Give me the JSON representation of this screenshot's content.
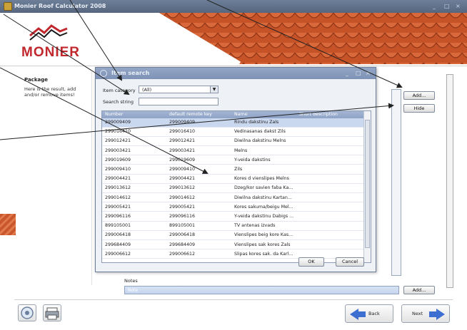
{
  "app": {
    "title": "Monier Roof Calculator 2008"
  },
  "logo": {
    "text": "MONIER"
  },
  "sidebar": {
    "title": "Package",
    "description": "Here is the result, add and/or remove items!"
  },
  "main": {
    "add_label": "Add...",
    "hide_label": "Hide",
    "notes_label": "Notes",
    "notes_value": "Note",
    "notes_add_label": "Add..."
  },
  "dialog": {
    "title": "Item search",
    "category_label": "Item category",
    "category_value": "(All)",
    "search_label": "Search string",
    "search_value": "",
    "columns": [
      "Number",
      "default remote key",
      "Name",
      "Short description"
    ],
    "rows": [
      [
        "299009409",
        "299009409",
        "Rindu dakstinu Zals",
        ""
      ],
      [
        "299016410",
        "299016410",
        "Vedinasanas dakst Zils",
        ""
      ],
      [
        "299012421",
        "299012421",
        "Diwilna dakstinu Melns",
        ""
      ],
      [
        "299003421",
        "299003421",
        "Melns",
        ""
      ],
      [
        "299019609",
        "299019609",
        "Y-veida dakstins",
        ""
      ],
      [
        "299009410",
        "299009410",
        "Zils",
        ""
      ],
      [
        "299004421",
        "299004421",
        "Kores d vienslipes Melns",
        ""
      ],
      [
        "299013612",
        "299013612",
        "Dzeg/kor savien faba Ka...",
        ""
      ],
      [
        "299014612",
        "299014612",
        "Diwilna dakstinu Kartan...",
        ""
      ],
      [
        "299005421",
        "299005421",
        "Kores sakuma/beigu Mel...",
        ""
      ],
      [
        "299096116",
        "299096116",
        "Y-veida dakstinu Dabigs ...",
        ""
      ],
      [
        "899105001",
        "899105001",
        "TV antenas izvads",
        ""
      ],
      [
        "299006418",
        "299006418",
        "Vienslipes beig kore Kas...",
        ""
      ],
      [
        "299684409",
        "299684409",
        "Vienslipes sak kores Zals",
        ""
      ],
      [
        "299006612",
        "299006612",
        "Slipas kores sak. da Karl...",
        ""
      ]
    ],
    "ok_label": "OK",
    "cancel_label": "Cancel"
  },
  "footer": {
    "back_label": "Back",
    "next_label": "Next"
  },
  "colors": {
    "brand_red": "#c0282d",
    "roof": "#c9562c",
    "titlebar": "#5f6f88",
    "selection": "#c9d7ef",
    "arrow": "#3d6fd1"
  }
}
